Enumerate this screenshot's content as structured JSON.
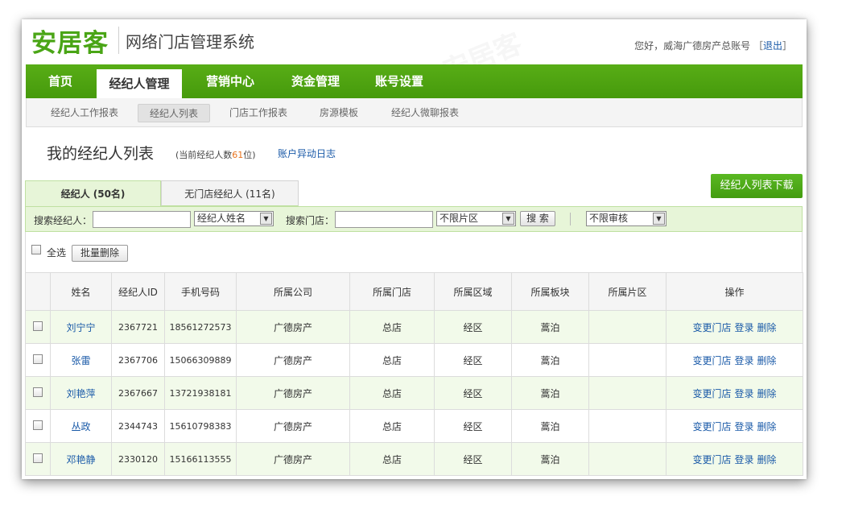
{
  "header": {
    "logo": "安居客",
    "system_name": "网络门店管理系统",
    "greeting": "您好，威海广德房产总账号",
    "logout": "退出"
  },
  "main_nav": [
    {
      "label": "首页",
      "active": false
    },
    {
      "label": "经纪人管理",
      "active": true
    },
    {
      "label": "营销中心",
      "active": false
    },
    {
      "label": "资金管理",
      "active": false
    },
    {
      "label": "账号设置",
      "active": false
    }
  ],
  "sub_nav": [
    {
      "label": "经纪人工作报表",
      "active": false
    },
    {
      "label": "经纪人列表",
      "active": true
    },
    {
      "label": "门店工作报表",
      "active": false
    },
    {
      "label": "房源模板",
      "active": false
    },
    {
      "label": "经纪人微聊报表",
      "active": false
    }
  ],
  "page": {
    "title": "我的经纪人列表",
    "count_prefix": "(当前经纪人数",
    "count_value": "61",
    "count_suffix": "位)",
    "log_link": "账户异动日志",
    "download_button": "经纪人列表下载"
  },
  "filter_tabs": [
    {
      "label": "经纪人 (50名)",
      "active": true
    },
    {
      "label": "无门店经纪人 (11名)",
      "active": false
    }
  ],
  "search": {
    "agent_label": "搜索经纪人：",
    "agent_value": "",
    "agent_field_select": "经纪人姓名",
    "store_label": "搜索门店：",
    "store_value": "",
    "area_select": "不限片区",
    "search_button": "搜 索",
    "audit_select": "不限审核"
  },
  "batch": {
    "select_all": "全选",
    "batch_delete": "批量删除"
  },
  "table": {
    "columns": [
      "",
      "姓名",
      "经纪人ID",
      "手机号码",
      "所属公司",
      "所属门店",
      "所属区域",
      "所属板块",
      "所属片区",
      "操作"
    ],
    "actions": [
      "变更门店",
      "登录",
      "删除"
    ],
    "rows": [
      {
        "name": "刘宁宁",
        "id": "2367721",
        "phone": "18561272573",
        "company": "广德房产",
        "store": "总店",
        "region": "经区",
        "block": "蒿泊",
        "area": ""
      },
      {
        "name": "张雷",
        "id": "2367706",
        "phone": "15066309889",
        "company": "广德房产",
        "store": "总店",
        "region": "经区",
        "block": "蒿泊",
        "area": ""
      },
      {
        "name": "刘艳萍",
        "id": "2367667",
        "phone": "13721938181",
        "company": "广德房产",
        "store": "总店",
        "region": "经区",
        "block": "蒿泊",
        "area": ""
      },
      {
        "name": "丛政",
        "id": "2344743",
        "phone": "15610798383",
        "company": "广德房产",
        "store": "总店",
        "region": "经区",
        "block": "蒿泊",
        "area": ""
      },
      {
        "name": "邓艳静",
        "id": "2330120",
        "phone": "15166113555",
        "company": "广德房产",
        "store": "总店",
        "region": "经区",
        "block": "蒿泊",
        "area": ""
      }
    ]
  },
  "colors": {
    "brand_green": "#4aa516",
    "link_blue": "#1a5aa8",
    "count_orange": "#e8731d",
    "row_tint": "#f2faea"
  }
}
